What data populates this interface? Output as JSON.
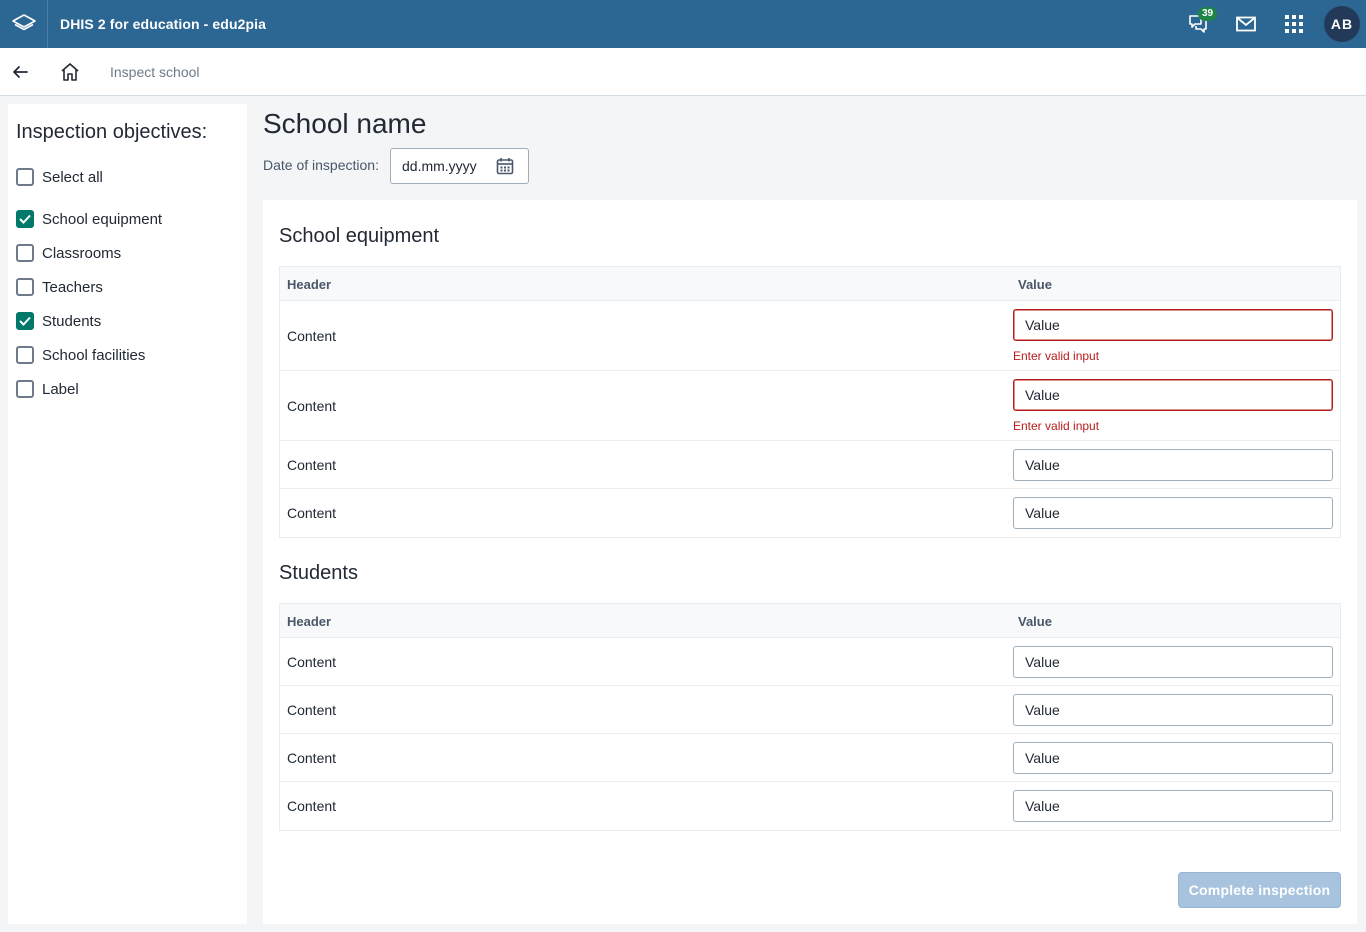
{
  "header": {
    "app_title": "DHIS 2 for education - edu2pia",
    "notification_count": "39",
    "avatar_initials": "AB"
  },
  "nav": {
    "breadcrumb": "Inspect school"
  },
  "sidebar": {
    "title": "Inspection objectives:",
    "items": [
      {
        "label": "Select all",
        "checked": false
      },
      {
        "label": "School equipment",
        "checked": true
      },
      {
        "label": "Classrooms",
        "checked": false
      },
      {
        "label": "Teachers",
        "checked": false
      },
      {
        "label": "Students",
        "checked": true
      },
      {
        "label": "School facilities",
        "checked": false
      },
      {
        "label": "Label",
        "checked": false
      }
    ]
  },
  "main": {
    "title": "School name",
    "date_label": "Date of inspection:",
    "date_placeholder": "dd.mm.yyyy",
    "sections": [
      {
        "title": "School equipment",
        "header_col1": "Header",
        "header_col2": "Value",
        "rows": [
          {
            "content": "Content",
            "value": "Value",
            "error": "Enter valid input"
          },
          {
            "content": "Content",
            "value": "Value",
            "error": "Enter valid input"
          },
          {
            "content": "Content",
            "value": "Value"
          },
          {
            "content": "Content",
            "value": "Value"
          }
        ]
      },
      {
        "title": "Students",
        "header_col1": "Header",
        "header_col2": "Value",
        "rows": [
          {
            "content": "Content",
            "value": "Value"
          },
          {
            "content": "Content",
            "value": "Value"
          },
          {
            "content": "Content",
            "value": "Value"
          },
          {
            "content": "Content",
            "value": "Value"
          }
        ]
      }
    ],
    "complete_button": "Complete inspection"
  },
  "colors": {
    "header_bg": "#2c6693",
    "checkbox_checked": "#00796b",
    "error": "#b71c1c",
    "badge": "#1e8448"
  }
}
